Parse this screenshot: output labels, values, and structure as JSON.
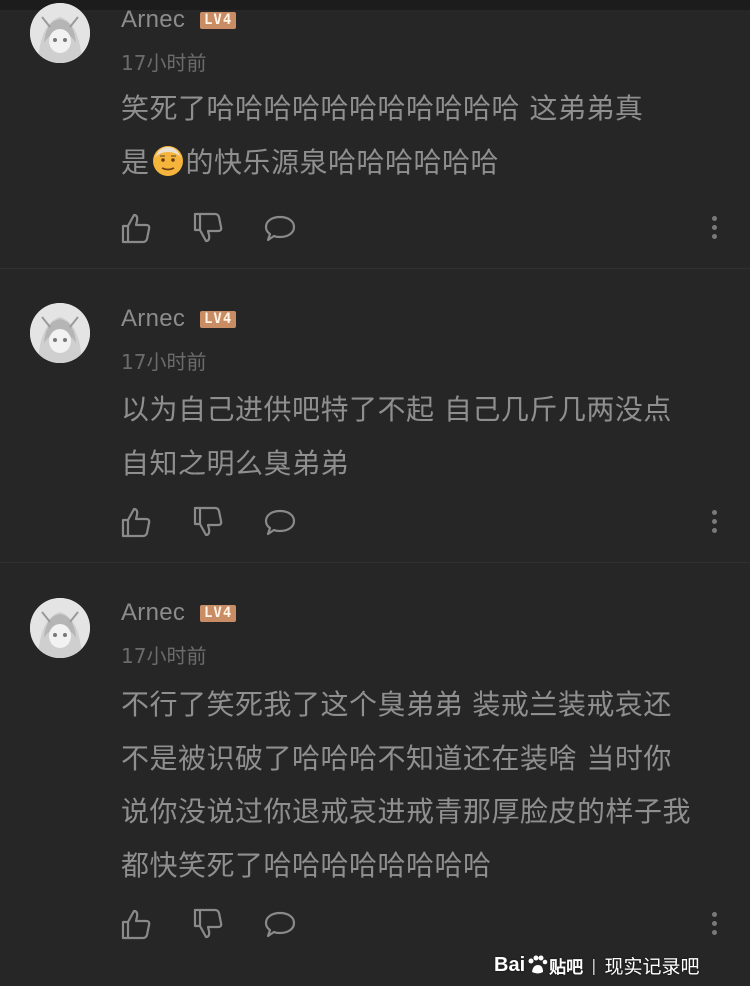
{
  "colors": {
    "background": "#262626",
    "text": "#8f8f8f",
    "timestamp": "#6b6b6b",
    "level_badge": "#c98d66"
  },
  "comments": [
    {
      "username": "Arnec",
      "level": "LV4",
      "timestamp": "17小时前",
      "lines": [
        "笑死了哈哈哈哈哈哈哈哈哈哈哈 这弟弟真",
        "的快乐源泉哈哈哈哈哈哈"
      ],
      "line2_prefix": "是",
      "emoji": "older-man-emoji"
    },
    {
      "username": "Arnec",
      "level": "LV4",
      "timestamp": "17小时前",
      "lines": [
        "以为自己进供吧特了不起 自己几斤几两没点",
        "自知之明么臭弟弟"
      ]
    },
    {
      "username": "Arnec",
      "level": "LV4",
      "timestamp": "17小时前",
      "lines": [
        "不行了笑死我了这个臭弟弟 装戒兰装戒哀还",
        "不是被识破了哈哈哈不知道还在装啥 当时你",
        "说你没说过你退戒哀进戒青那厚脸皮的样子我",
        "都快笑死了哈哈哈哈哈哈哈哈"
      ]
    }
  ],
  "watermark": {
    "logo_left": "Bai",
    "logo_right": "贴吧",
    "separator": "|",
    "source": "现实记录吧"
  },
  "icons": [
    "like-icon",
    "dislike-icon",
    "reply-icon",
    "more-icon",
    "avatar"
  ]
}
